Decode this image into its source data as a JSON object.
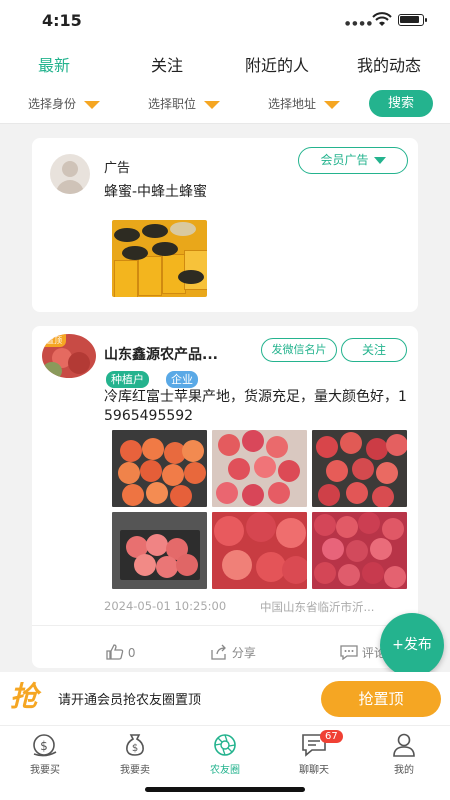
{
  "status_bar": {
    "time": "4:15"
  },
  "tabs": [
    {
      "label": "最新",
      "active": true
    },
    {
      "label": "关注",
      "active": false
    },
    {
      "label": "附近的人",
      "active": false
    },
    {
      "label": "我的动态",
      "active": false
    }
  ],
  "filters": {
    "identity": "选择身份",
    "position": "选择职位",
    "address": "选择地址",
    "search": "搜索"
  },
  "ad_post": {
    "label": "广告",
    "title": "蜂蜜-中蜂土蜂蜜",
    "member_ad_button": "会员广告"
  },
  "post": {
    "author": "山东鑫源农产品...",
    "avatar_badge": "置顶",
    "tags": [
      "种植户",
      "企业"
    ],
    "wechat_card_button": "发微信名片",
    "follow_button": "关注",
    "content": "冷库红富士苹果产地，货源充足，量大颜色好，15965495592",
    "timestamp": "2024-05-01 10:25:00",
    "location": "中国山东省临沂市沂...",
    "likes": "0",
    "share_label": "分享",
    "comment_label": "评论"
  },
  "fab": {
    "label": "+发布"
  },
  "promo": {
    "icon_text": "抢",
    "text": "请开通会员抢农友圈置顶",
    "button": "抢置顶"
  },
  "nav": [
    {
      "label": "我要买",
      "icon": "buy-money-icon",
      "active": false
    },
    {
      "label": "我要卖",
      "icon": "sell-money-bag-icon",
      "active": false
    },
    {
      "label": "农友圈",
      "icon": "camera-aperture-icon",
      "active": true
    },
    {
      "label": "聊聊天",
      "icon": "chat-bubble-icon",
      "active": false,
      "badge": "67"
    },
    {
      "label": "我的",
      "icon": "person-icon",
      "active": false
    }
  ],
  "colors": {
    "accent": "#24b38e",
    "orange": "#f5a623",
    "badge_red": "#f04134",
    "tag_green": "#24b38e",
    "tag_blue": "#5aa9e6"
  }
}
